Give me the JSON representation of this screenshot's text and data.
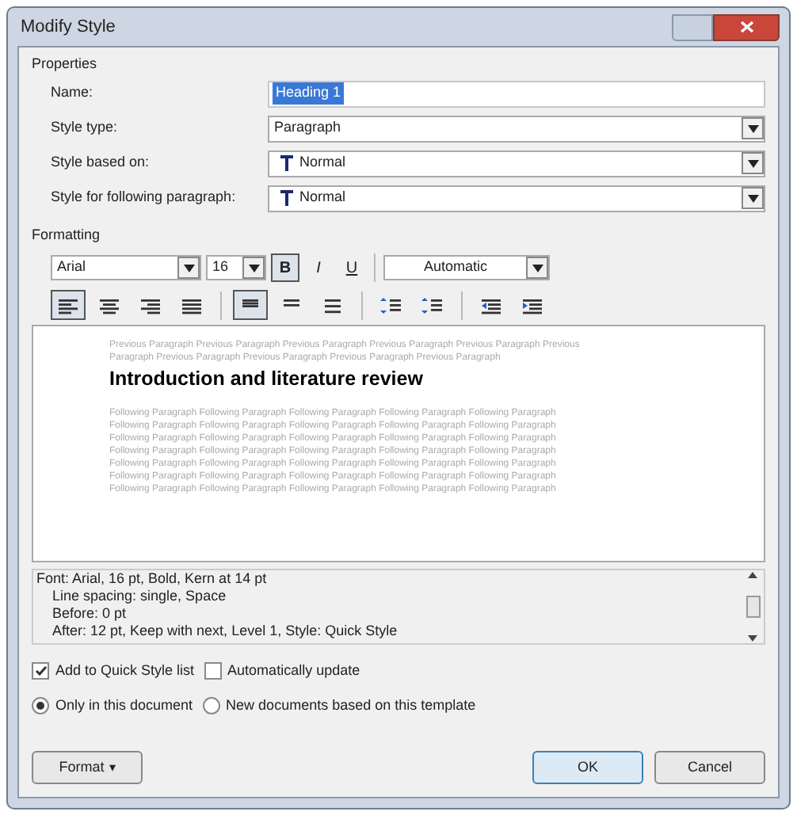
{
  "window": {
    "title": "Modify Style"
  },
  "properties": {
    "heading": "Properties",
    "fields": [
      {
        "label": "Name:",
        "kind": "text",
        "value": "Heading 1",
        "selected": true
      },
      {
        "label": "Style type:",
        "kind": "select",
        "value": "Paragraph",
        "style_icon": false
      },
      {
        "label": "Style based on:",
        "kind": "select",
        "value": "Normal",
        "style_icon": true
      },
      {
        "label": "Style for following paragraph:",
        "kind": "select",
        "value": "Normal",
        "style_icon": true
      }
    ]
  },
  "formatting": {
    "heading": "Formatting",
    "font": "Arial",
    "size": "16",
    "font_color_setting": "Automatic",
    "font_buttons": [
      {
        "kind": "bold",
        "label": "B",
        "selected": true
      },
      {
        "kind": "italic",
        "label": "I",
        "selected": false
      },
      {
        "kind": "underline",
        "label": "U",
        "selected": false
      }
    ],
    "para_buttons": [
      {
        "kind": "align-left",
        "selected": true
      },
      {
        "kind": "align-center",
        "selected": false
      },
      {
        "kind": "align-right",
        "selected": false
      },
      {
        "kind": "justify",
        "selected": false
      },
      {
        "kind": "sep"
      },
      {
        "kind": "single-spacing",
        "selected": true
      },
      {
        "kind": "one-half-spacing",
        "selected": false
      },
      {
        "kind": "double-spacing",
        "selected": false
      },
      {
        "kind": "sep"
      },
      {
        "kind": "space-before",
        "selected": false
      },
      {
        "kind": "space-after",
        "selected": false
      },
      {
        "kind": "sep"
      },
      {
        "kind": "outdent",
        "selected": false
      },
      {
        "kind": "indent",
        "selected": false
      }
    ],
    "preview": {
      "previous": [
        "Previous Paragraph Previous Paragraph Previous Paragraph Previous Paragraph Previous Paragraph Previous",
        "Paragraph Previous Paragraph Previous Paragraph Previous Paragraph Previous Paragraph"
      ],
      "sample": "Introduction and literature review",
      "following": [
        "Following Paragraph Following Paragraph Following Paragraph Following Paragraph Following Paragraph",
        "Following Paragraph Following Paragraph Following Paragraph Following Paragraph Following Paragraph",
        "Following Paragraph Following Paragraph Following Paragraph Following Paragraph Following Paragraph",
        "Following Paragraph Following Paragraph Following Paragraph Following Paragraph Following Paragraph",
        "Following Paragraph Following Paragraph Following Paragraph Following Paragraph Following Paragraph",
        "Following Paragraph Following Paragraph Following Paragraph Following Paragraph Following Paragraph",
        "Following Paragraph Following Paragraph Following Paragraph Following Paragraph Following Paragraph"
      ]
    },
    "description": [
      "Font: Arial, 16 pt, Bold, Kern at 14 pt",
      "Line spacing:  single, Space",
      "Before:  0 pt",
      "After:  12 pt, Keep with next, Level 1, Style: Quick Style"
    ]
  },
  "checkboxes": [
    {
      "label": "Add to Quick Style list",
      "checked": true
    },
    {
      "label": "Automatically update",
      "checked": false
    }
  ],
  "radios": [
    {
      "label": "Only in this document",
      "selected": true
    },
    {
      "label": "New documents based on this template",
      "selected": false
    }
  ],
  "buttons": {
    "format": "Format",
    "format_caret": "▾",
    "ok": "OK",
    "cancel": "Cancel"
  }
}
